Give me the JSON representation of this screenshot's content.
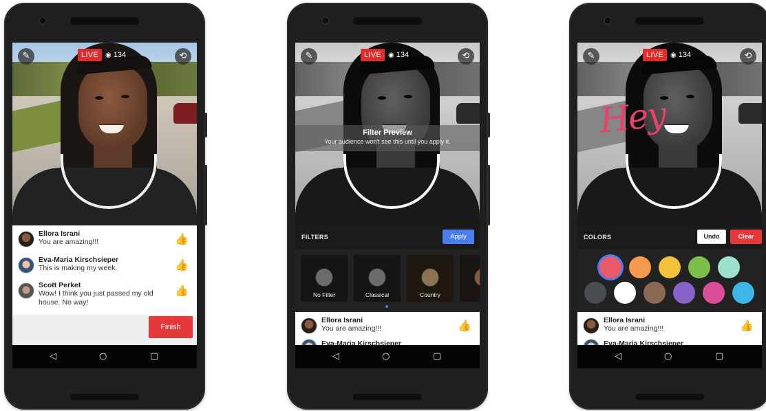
{
  "stream": {
    "live_label": "LIVE",
    "viewer_count": "134"
  },
  "phone1": {
    "comments": [
      {
        "name": "Ellora Israni",
        "text": "You are amazing!!!",
        "liked": true
      },
      {
        "name": "Eva-Maria Kirschsieper",
        "text": "This is making my week.",
        "liked": false
      },
      {
        "name": "Scott Perket",
        "text": "Wow! I think you just passed my old house. No way!",
        "liked": false
      }
    ],
    "finish_label": "Finish"
  },
  "phone2": {
    "preview_title": "Filter Preview",
    "preview_subtitle": "Your audience won't see this until you apply it.",
    "bar_label": "FILTERS",
    "apply_label": "Apply",
    "filters": [
      "No Filter",
      "Classical",
      "Country"
    ],
    "comment": {
      "name": "Ellora Israni",
      "text": "You are amazing!!!"
    },
    "next_comment_name": "Eva-Maria Kirschsieper"
  },
  "phone3": {
    "drawing_text": "Hey",
    "bar_label": "COLORS",
    "undo_label": "Undo",
    "clear_label": "Clear",
    "colors_row1": [
      "#e85a6a",
      "#f59a4c",
      "#f2c23a",
      "#7ebf4a",
      "#9fe0cf"
    ],
    "colors_row2": [
      "#4a4d51",
      "#ffffff",
      "#8a6a55",
      "#8a62c9",
      "#dc4d9a",
      "#3fb6e8"
    ],
    "selected_color": "#e85a6a",
    "comment": {
      "name": "Ellora Israni",
      "text": "You are amazing!!!"
    },
    "next_comment_name": "Eva-Maria Kirschsieper"
  },
  "colors": {
    "live_red": "#e32b2b",
    "like_blue": "#4a7ef0",
    "finish_red": "#e4383a",
    "drawing_pink": "#e6426a"
  },
  "icons": [
    "magic-wand-icon",
    "switch-camera-icon",
    "eye-icon",
    "thumbs-up-icon",
    "pencil-icon",
    "back-icon",
    "home-icon",
    "recents-icon"
  ]
}
